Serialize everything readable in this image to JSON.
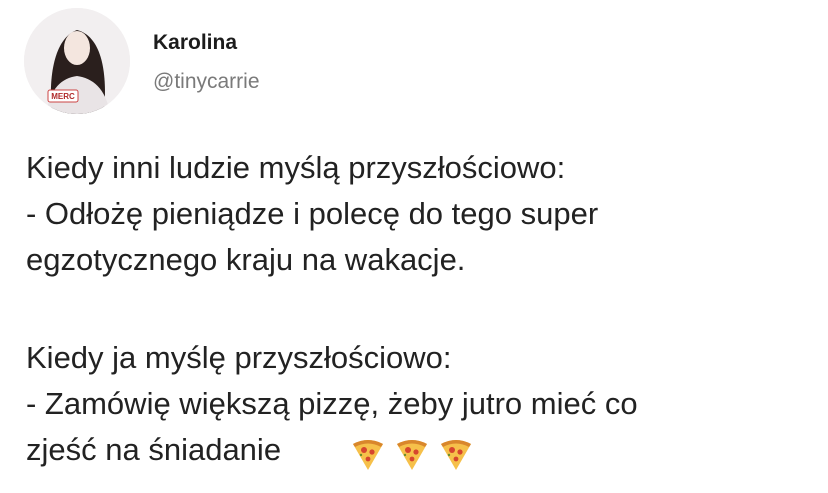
{
  "author": {
    "name": "Karolina",
    "handle": "@tinycarrie",
    "avatar_icon": "profile-photo-avatar",
    "avatar_badge_text": "MERC"
  },
  "tweet": {
    "lines": [
      "Kiedy inni ludzie myślą przyszłościowo:",
      "- Odłożę pieniądze i polecę do tego super",
      "egzotycznego kraju na wakacje.",
      "Kiedy ja myślę przyszłościowo:",
      "- Zamówię większą pizzę, żeby jutro mieć co",
      "zjeść na śniadanie"
    ],
    "emoji": [
      "pizza-icon",
      "pizza-icon",
      "pizza-icon"
    ]
  }
}
